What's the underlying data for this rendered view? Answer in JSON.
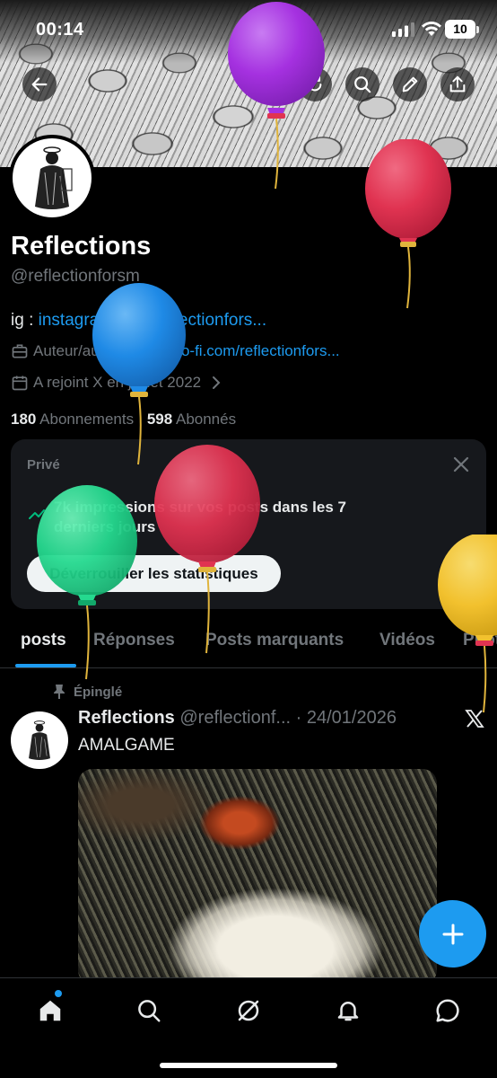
{
  "status_bar": {
    "time": "00:14",
    "battery": "10"
  },
  "header": {
    "display_name": "Reflections",
    "handle": "@reflectionforsm",
    "bio_prefix": "ig : ",
    "bio_link": "instagram.com/reflectionfors...",
    "category": "Auteur/auteure",
    "website": "ko-fi.com/reflectionfors...",
    "joined": "A rejoint X en juillet 2022",
    "following_count": "180",
    "following_label": "Abonnements",
    "followers_count": "598",
    "followers_label": "Abonnés"
  },
  "stats_card": {
    "label": "Privé",
    "text": "7k impressions sur vos posts dans les 7 derniers jours",
    "button": "Déverrouiller les statistiques"
  },
  "tabs": [
    "posts",
    "Réponses",
    "Posts marquants",
    "Vidéos",
    "Photos"
  ],
  "pinned_post": {
    "pinned_label": "Épinglé",
    "name": "Reflections",
    "handle": "@reflectionf...",
    "separator": "·",
    "date": "24/01/2026",
    "text": "AMALGAME"
  },
  "icons": {
    "back": "arrow-left-icon",
    "refresh": "refresh-icon",
    "search": "search-icon",
    "edit": "pencil-icon",
    "share": "share-icon",
    "close": "close-icon",
    "stats": "trend-up-icon",
    "pin": "pin-icon",
    "x_logo": "x-logo-icon",
    "compose": "plus-icon",
    "nav": [
      "home-icon",
      "search-icon",
      "grok-icon",
      "bell-icon",
      "chat-icon"
    ]
  },
  "colors": {
    "accent": "#1d9bf0",
    "balloon_purple": "#a531e0",
    "balloon_red": "#e03351",
    "balloon_blue": "#1f8ae6",
    "balloon_green": "#25d98f",
    "balloon_yellow": "#f2c12e"
  }
}
